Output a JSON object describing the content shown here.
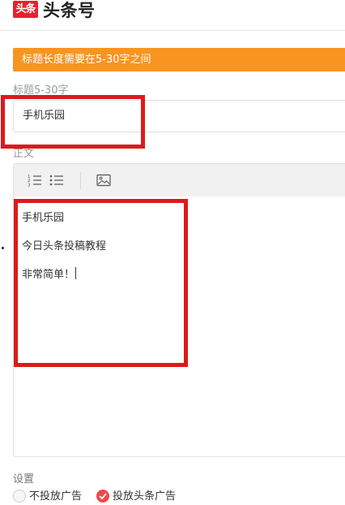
{
  "header": {
    "logo_badge": "头条",
    "logo_text": "头条号"
  },
  "warning": {
    "text": "标题长度需要在5-30字之间",
    "color": "#f89520"
  },
  "title_field": {
    "label": "标题5-30字",
    "value": "手机乐园"
  },
  "body_field": {
    "label": "正文",
    "toolbar": [
      {
        "name": "ordered-list-icon"
      },
      {
        "name": "unordered-list-icon"
      },
      {
        "name": "image-icon"
      }
    ],
    "paragraphs": [
      "手机乐园",
      "今日头条投稿教程",
      "非常简单！"
    ]
  },
  "settings": {
    "label": "设置",
    "options": [
      {
        "label": "不投放广告",
        "checked": false
      },
      {
        "label": "投放头条广告",
        "checked": true
      }
    ]
  },
  "accent_colors": {
    "brand": "#e8212e",
    "highlight": "#dd1a1a"
  }
}
